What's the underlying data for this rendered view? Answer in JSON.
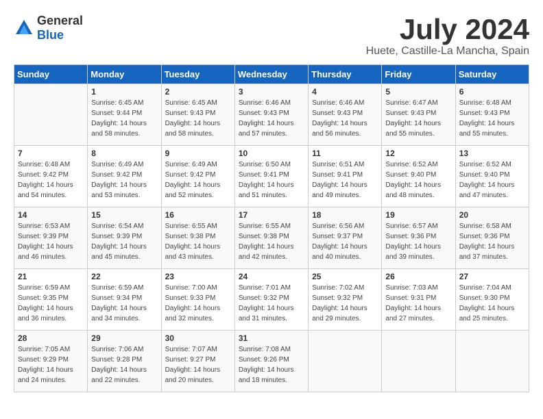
{
  "header": {
    "logo_general": "General",
    "logo_blue": "Blue",
    "month_year": "July 2024",
    "location": "Huete, Castille-La Mancha, Spain"
  },
  "weekdays": [
    "Sunday",
    "Monday",
    "Tuesday",
    "Wednesday",
    "Thursday",
    "Friday",
    "Saturday"
  ],
  "weeks": [
    [
      {
        "day": "",
        "sunrise": "",
        "sunset": "",
        "daylight": ""
      },
      {
        "day": "1",
        "sunrise": "Sunrise: 6:45 AM",
        "sunset": "Sunset: 9:44 PM",
        "daylight": "Daylight: 14 hours and 58 minutes."
      },
      {
        "day": "2",
        "sunrise": "Sunrise: 6:45 AM",
        "sunset": "Sunset: 9:43 PM",
        "daylight": "Daylight: 14 hours and 58 minutes."
      },
      {
        "day": "3",
        "sunrise": "Sunrise: 6:46 AM",
        "sunset": "Sunset: 9:43 PM",
        "daylight": "Daylight: 14 hours and 57 minutes."
      },
      {
        "day": "4",
        "sunrise": "Sunrise: 6:46 AM",
        "sunset": "Sunset: 9:43 PM",
        "daylight": "Daylight: 14 hours and 56 minutes."
      },
      {
        "day": "5",
        "sunrise": "Sunrise: 6:47 AM",
        "sunset": "Sunset: 9:43 PM",
        "daylight": "Daylight: 14 hours and 55 minutes."
      },
      {
        "day": "6",
        "sunrise": "Sunrise: 6:48 AM",
        "sunset": "Sunset: 9:43 PM",
        "daylight": "Daylight: 14 hours and 55 minutes."
      }
    ],
    [
      {
        "day": "7",
        "sunrise": "Sunrise: 6:48 AM",
        "sunset": "Sunset: 9:42 PM",
        "daylight": "Daylight: 14 hours and 54 minutes."
      },
      {
        "day": "8",
        "sunrise": "Sunrise: 6:49 AM",
        "sunset": "Sunset: 9:42 PM",
        "daylight": "Daylight: 14 hours and 53 minutes."
      },
      {
        "day": "9",
        "sunrise": "Sunrise: 6:49 AM",
        "sunset": "Sunset: 9:42 PM",
        "daylight": "Daylight: 14 hours and 52 minutes."
      },
      {
        "day": "10",
        "sunrise": "Sunrise: 6:50 AM",
        "sunset": "Sunset: 9:41 PM",
        "daylight": "Daylight: 14 hours and 51 minutes."
      },
      {
        "day": "11",
        "sunrise": "Sunrise: 6:51 AM",
        "sunset": "Sunset: 9:41 PM",
        "daylight": "Daylight: 14 hours and 49 minutes."
      },
      {
        "day": "12",
        "sunrise": "Sunrise: 6:52 AM",
        "sunset": "Sunset: 9:40 PM",
        "daylight": "Daylight: 14 hours and 48 minutes."
      },
      {
        "day": "13",
        "sunrise": "Sunrise: 6:52 AM",
        "sunset": "Sunset: 9:40 PM",
        "daylight": "Daylight: 14 hours and 47 minutes."
      }
    ],
    [
      {
        "day": "14",
        "sunrise": "Sunrise: 6:53 AM",
        "sunset": "Sunset: 9:39 PM",
        "daylight": "Daylight: 14 hours and 46 minutes."
      },
      {
        "day": "15",
        "sunrise": "Sunrise: 6:54 AM",
        "sunset": "Sunset: 9:39 PM",
        "daylight": "Daylight: 14 hours and 45 minutes."
      },
      {
        "day": "16",
        "sunrise": "Sunrise: 6:55 AM",
        "sunset": "Sunset: 9:38 PM",
        "daylight": "Daylight: 14 hours and 43 minutes."
      },
      {
        "day": "17",
        "sunrise": "Sunrise: 6:55 AM",
        "sunset": "Sunset: 9:38 PM",
        "daylight": "Daylight: 14 hours and 42 minutes."
      },
      {
        "day": "18",
        "sunrise": "Sunrise: 6:56 AM",
        "sunset": "Sunset: 9:37 PM",
        "daylight": "Daylight: 14 hours and 40 minutes."
      },
      {
        "day": "19",
        "sunrise": "Sunrise: 6:57 AM",
        "sunset": "Sunset: 9:36 PM",
        "daylight": "Daylight: 14 hours and 39 minutes."
      },
      {
        "day": "20",
        "sunrise": "Sunrise: 6:58 AM",
        "sunset": "Sunset: 9:36 PM",
        "daylight": "Daylight: 14 hours and 37 minutes."
      }
    ],
    [
      {
        "day": "21",
        "sunrise": "Sunrise: 6:59 AM",
        "sunset": "Sunset: 9:35 PM",
        "daylight": "Daylight: 14 hours and 36 minutes."
      },
      {
        "day": "22",
        "sunrise": "Sunrise: 6:59 AM",
        "sunset": "Sunset: 9:34 PM",
        "daylight": "Daylight: 14 hours and 34 minutes."
      },
      {
        "day": "23",
        "sunrise": "Sunrise: 7:00 AM",
        "sunset": "Sunset: 9:33 PM",
        "daylight": "Daylight: 14 hours and 32 minutes."
      },
      {
        "day": "24",
        "sunrise": "Sunrise: 7:01 AM",
        "sunset": "Sunset: 9:32 PM",
        "daylight": "Daylight: 14 hours and 31 minutes."
      },
      {
        "day": "25",
        "sunrise": "Sunrise: 7:02 AM",
        "sunset": "Sunset: 9:32 PM",
        "daylight": "Daylight: 14 hours and 29 minutes."
      },
      {
        "day": "26",
        "sunrise": "Sunrise: 7:03 AM",
        "sunset": "Sunset: 9:31 PM",
        "daylight": "Daylight: 14 hours and 27 minutes."
      },
      {
        "day": "27",
        "sunrise": "Sunrise: 7:04 AM",
        "sunset": "Sunset: 9:30 PM",
        "daylight": "Daylight: 14 hours and 25 minutes."
      }
    ],
    [
      {
        "day": "28",
        "sunrise": "Sunrise: 7:05 AM",
        "sunset": "Sunset: 9:29 PM",
        "daylight": "Daylight: 14 hours and 24 minutes."
      },
      {
        "day": "29",
        "sunrise": "Sunrise: 7:06 AM",
        "sunset": "Sunset: 9:28 PM",
        "daylight": "Daylight: 14 hours and 22 minutes."
      },
      {
        "day": "30",
        "sunrise": "Sunrise: 7:07 AM",
        "sunset": "Sunset: 9:27 PM",
        "daylight": "Daylight: 14 hours and 20 minutes."
      },
      {
        "day": "31",
        "sunrise": "Sunrise: 7:08 AM",
        "sunset": "Sunset: 9:26 PM",
        "daylight": "Daylight: 14 hours and 18 minutes."
      },
      {
        "day": "",
        "sunrise": "",
        "sunset": "",
        "daylight": ""
      },
      {
        "day": "",
        "sunrise": "",
        "sunset": "",
        "daylight": ""
      },
      {
        "day": "",
        "sunrise": "",
        "sunset": "",
        "daylight": ""
      }
    ]
  ]
}
